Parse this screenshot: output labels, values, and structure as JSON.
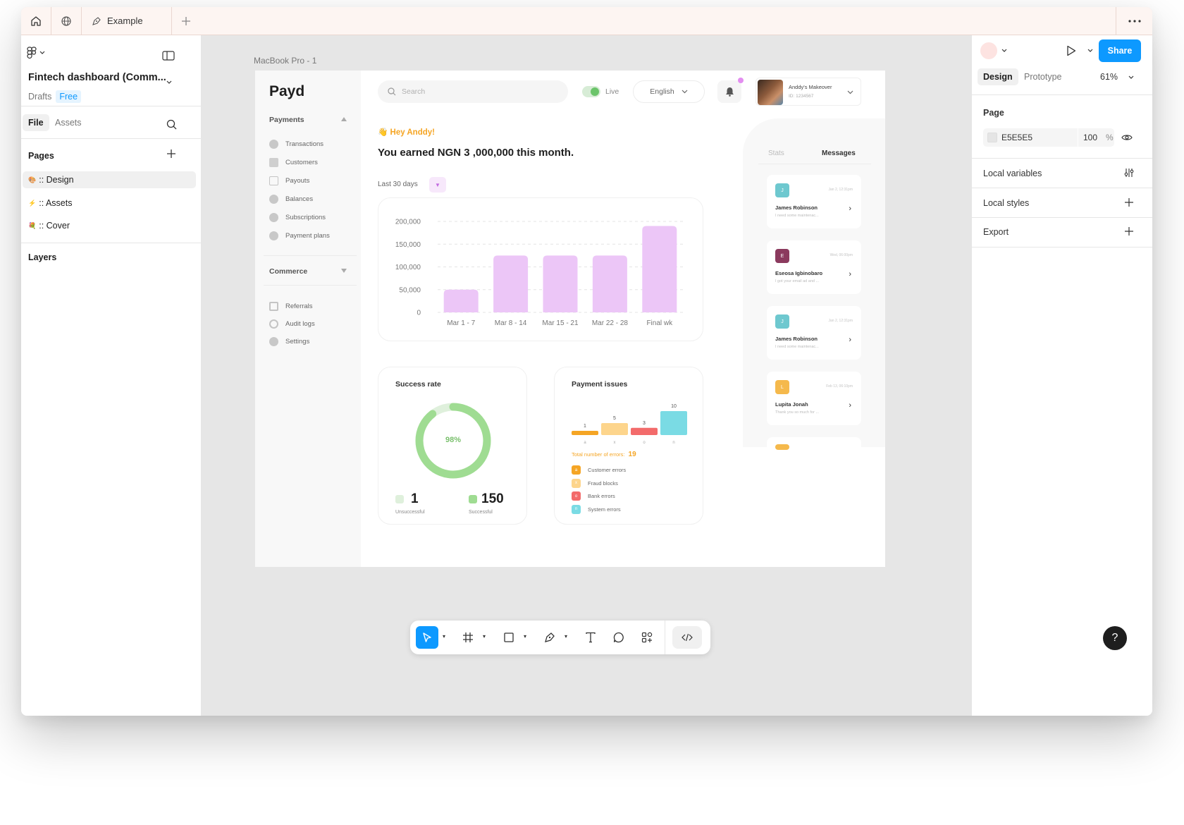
{
  "tabbar": {
    "file_tab_label": "Example"
  },
  "left_panel": {
    "file_name": "Fintech dashboard (Comm...",
    "drafts_label": "Drafts",
    "plan_badge": "Free",
    "tabs": [
      "File",
      "Assets"
    ],
    "pages_heading": "Pages",
    "pages": [
      {
        "emoji": "🎨",
        "label": ":: Design",
        "selected": true
      },
      {
        "emoji": "⚡",
        "label": ":: Assets",
        "selected": false
      },
      {
        "emoji": "💐",
        "label": ":: Cover",
        "selected": false
      }
    ],
    "layers_heading": "Layers"
  },
  "right_panel": {
    "share_label": "Share",
    "tabs": [
      "Design",
      "Prototype"
    ],
    "zoom": "61%",
    "page_heading": "Page",
    "page_color": "E5E5E5",
    "page_opacity": "100",
    "percent": "%",
    "local_variables": "Local variables",
    "local_styles": "Local styles",
    "export": "Export",
    "help": "?"
  },
  "canvas": {
    "frame_label": "MacBook Pro - 1"
  },
  "dashboard": {
    "logo": "Payd",
    "payments_section": "Payments",
    "payments_items": [
      "Transactions",
      "Customers",
      "Payouts",
      "Balances",
      "Subscriptions",
      "Payment plans"
    ],
    "commerce_section": "Commerce",
    "commerce_items": [
      "Referrals",
      "Audit logs",
      "Settings"
    ],
    "search_placeholder": "Search",
    "live_label": "Live",
    "language": "English",
    "profile_name": "Anddy's Makeover",
    "profile_id": "ID: 1234567",
    "greeting": "Hey Anddy!",
    "earned": "You earned NGN 3 ,000,000 this month.",
    "period": "Last 30 days",
    "success_title": "Success rate",
    "success_percent": "98%",
    "unsuccessful_count": "1",
    "unsuccessful_label": "Unsuccessful",
    "successful_count": "150",
    "successful_label": "Successful",
    "issues_title": "Payment issues",
    "errors_label": "Total number of errors:",
    "errors_total": "19",
    "legend": [
      {
        "letter": "a",
        "label": "Customer errors",
        "color": "#f5a524"
      },
      {
        "letter": "x",
        "label": "Fraud blocks",
        "color": "#fdd58c"
      },
      {
        "letter": "o",
        "label": "Bank errors",
        "color": "#f36b6b"
      },
      {
        "letter": "n",
        "label": "System errors",
        "color": "#7adbe4"
      }
    ],
    "messages_tabs": [
      "Stats",
      "Messages"
    ],
    "messages": [
      {
        "initial": "J",
        "name": "James Robinson",
        "preview": "I need some maintenac...",
        "date": "Jan 2, 12:31pm",
        "color": "#6ec8cf"
      },
      {
        "initial": "E",
        "name": "Eseosa Igbinobaro",
        "preview": "I got your email ad and ...",
        "date": "Wed, 06:00pm",
        "color": "#8b3a5e"
      },
      {
        "initial": "J",
        "name": "James Robinson",
        "preview": "I need some maintenac...",
        "date": "Jan 2, 12:31pm",
        "color": "#6ec8cf"
      },
      {
        "initial": "L",
        "name": "Lupita Jonah",
        "preview": "Thank you so much for ...",
        "date": "Feb 13, 06:10pm",
        "color": "#f5b94c"
      }
    ]
  },
  "chart_data": [
    {
      "type": "bar",
      "categories": [
        "Mar 1 - 7",
        "Mar 8 - 14",
        "Mar 15 - 21",
        "Mar 22 - 28",
        "Final wk"
      ],
      "values": [
        50000,
        125000,
        125000,
        125000,
        190000
      ],
      "ylim": [
        0,
        200000
      ],
      "yticks": [
        "200,000",
        "150,000",
        "100,000",
        "50,000",
        "0"
      ],
      "grid": true,
      "color": "#ecc6f7"
    },
    {
      "type": "pie",
      "title": "Success rate",
      "categories": [
        "Unsuccessful",
        "Successful"
      ],
      "values": [
        1,
        150
      ],
      "center_label": "98%",
      "colors": [
        "#dff0dc",
        "#9fdc92"
      ]
    },
    {
      "type": "bar",
      "title": "Payment issues",
      "categories": [
        "a",
        "x",
        "o",
        "n"
      ],
      "values": [
        1,
        5,
        3,
        10
      ],
      "colors": [
        "#f5a524",
        "#fdd58c",
        "#f36b6b",
        "#7adbe4"
      ]
    }
  ]
}
